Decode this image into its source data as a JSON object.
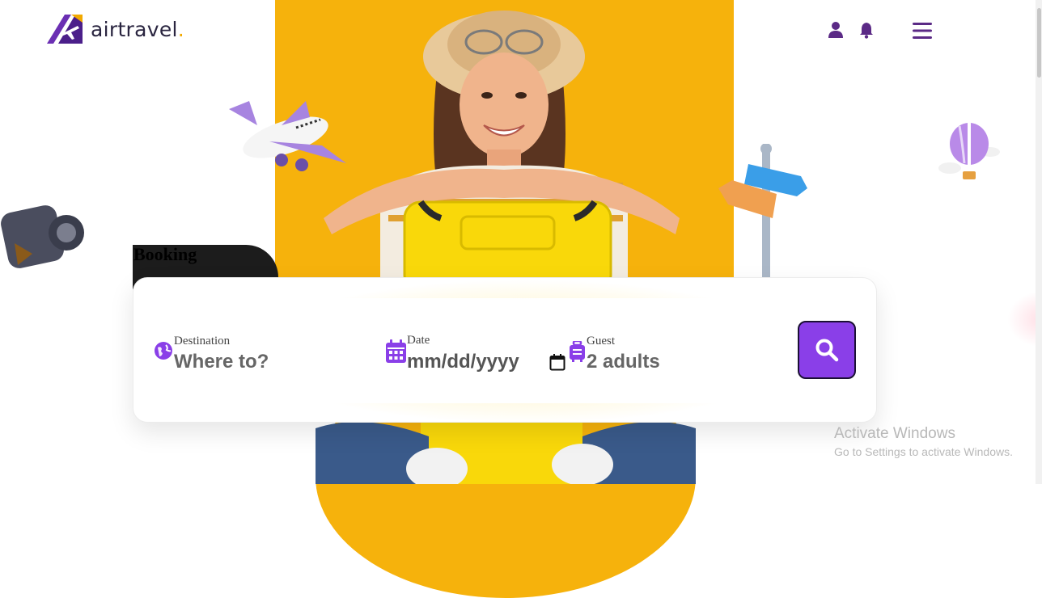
{
  "brand": {
    "name": "airtravel",
    "dot": ".",
    "accent_color": "#f2a900",
    "primary_color": "#5b2a86"
  },
  "header": {
    "icons": [
      "user-icon",
      "bell-icon",
      "hamburger-menu-icon"
    ]
  },
  "booking": {
    "title": "Booking",
    "fields": {
      "destination": {
        "label": "Destination",
        "placeholder": "Where to?",
        "icon": "globe-icon"
      },
      "date": {
        "label": "Date",
        "placeholder": "mm/dd/yyyy",
        "icon": "calendar-icon"
      },
      "guest": {
        "label": "Guest",
        "placeholder": "2 adults",
        "icon": "luggage-icon"
      }
    },
    "search_icon": "search-icon",
    "search_button_color": "#8a3fe8"
  },
  "watermark": {
    "title": "Activate Windows",
    "subtitle": "Go to Settings to activate Windows."
  },
  "colors": {
    "hero_yellow": "#f6b20c",
    "purple": "#8a3fe8"
  }
}
